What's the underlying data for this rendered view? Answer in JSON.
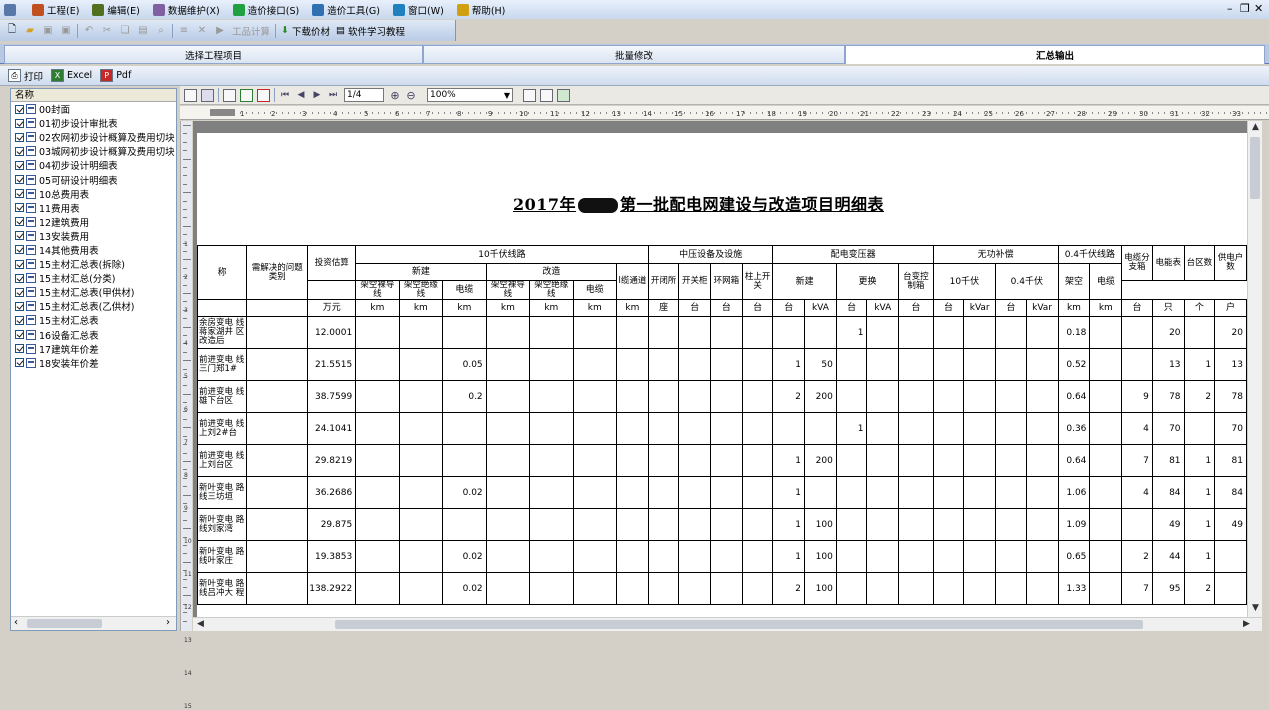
{
  "menu": [
    {
      "label": "工程(E)",
      "icon": "project-icon",
      "color": "#c05020"
    },
    {
      "label": "编辑(E)",
      "icon": "edit-icon",
      "color": "#507020"
    },
    {
      "label": "数据维护(X)",
      "icon": "data-maintain-icon",
      "color": "#8060a0"
    },
    {
      "label": "造价接口(S)",
      "icon": "cost-interface-icon",
      "color": "#20a040"
    },
    {
      "label": "造价工具(G)",
      "icon": "cost-tool-icon",
      "color": "#3070b0"
    },
    {
      "label": "窗口(W)",
      "icon": "window-icon",
      "color": "#2080c0"
    },
    {
      "label": "帮助(H)",
      "icon": "help-icon",
      "color": "#d0a010"
    }
  ],
  "toolbar": {
    "calc_label": "工品计算",
    "download_label": "下载价材",
    "tutorial_label": "软件学习教程"
  },
  "tabs": [
    "选择工程项目",
    "批量修改",
    "汇总输出"
  ],
  "export_toolbar": {
    "print": "打印",
    "excel": "Excel",
    "pdf": "Pdf"
  },
  "tree": {
    "header": "名称",
    "items": [
      "00封面",
      "01初步设计审批表",
      "02农网初步设计概算及费用切块",
      "03城网初步设计概算及费用切块",
      "04初步设计明细表",
      "05可研设计明细表",
      "10总费用表",
      "11费用表",
      "12建筑费用",
      "13安装费用",
      "14其他费用表",
      "15主材汇总表(拆除)",
      "15主材汇总(分类)",
      "15主材汇总表(甲供材)",
      "15主材汇总表(乙供材)",
      "15主材汇总表",
      "16设备汇总表",
      "17建筑年价差",
      "18安装年价差"
    ]
  },
  "viewer": {
    "page": "1/4",
    "zoom": "100%"
  },
  "ruler": [
    "1",
    "2",
    "3",
    "4",
    "5",
    "6",
    "7",
    "8",
    "9",
    "10",
    "11",
    "12",
    "13",
    "14",
    "15",
    "16",
    "17",
    "18",
    "19",
    "20",
    "21",
    "22",
    "23",
    "24",
    "25",
    "26",
    "27",
    "28",
    "29",
    "30",
    "31",
    "32",
    "33"
  ],
  "vruler": [
    "1",
    "2",
    "3",
    "4",
    "5",
    "6",
    "7",
    "8",
    "9",
    "10",
    "11",
    "12",
    "13",
    "14",
    "15"
  ],
  "report": {
    "title_prefix": "2017年",
    "title_suffix": "第一批配电网建设与改造项目明细表",
    "headers": {
      "name": "称",
      "category": "需解决的问题类别",
      "investment": "投资估算",
      "unit_wanyuan": "万元",
      "kv10": "10千伏线路",
      "mv": "中压设备及设施",
      "transformer": "配电变压器",
      "reactive": "无功补偿",
      "kv04": "0.4千伏线路",
      "cable_branch": "电缆分支箱",
      "meter": "电能表",
      "area_count": "台区数",
      "supply": "供电户数",
      "new": "新建",
      "rebuild": "改造",
      "overhead_bare": "架空裸导线",
      "overhead_insulated": "架空绝缘线",
      "cable": "电缆",
      "cable_channel": "l缆通道",
      "switch_station": "开闭所",
      "switch_cabinet": "开关柜",
      "ring_unit": "环网箱",
      "pole_switch": "柱上开关",
      "tr_new": "新建",
      "tr_replace": "更换",
      "tr_control": "台变控制箱",
      "rc_10kv": "10千伏",
      "rc_04kv": "0.4千伏",
      "lv_overhead": "架空",
      "lv_cable": "电缆",
      "units": [
        "km",
        "km",
        "km",
        "km",
        "km",
        "km",
        "km",
        "座",
        "台",
        "台",
        "台",
        "台",
        "kVA",
        "台",
        "kVA",
        "台",
        "台",
        "kVar",
        "台",
        "kVar",
        "km",
        "km",
        "台",
        "只",
        "个",
        "户"
      ]
    },
    "rows": [
      {
        "name": "余房变电 线蒋家湖井 区改造后",
        "inv": "12.0001",
        "ins": "",
        "tnew": "",
        "tkva": "",
        "trep": "1",
        "lvo": "0.18",
        "box": "",
        "meter": "20",
        "area": "",
        "sup": "20"
      },
      {
        "name": "前进变电 线三门郑1#",
        "inv": "21.5515",
        "ins": "0.05",
        "tnew": "1",
        "tkva": "50",
        "trep": "",
        "lvo": "0.52",
        "box": "",
        "meter": "13",
        "area": "1",
        "sup": "13"
      },
      {
        "name": "前进变电 线雄下台区",
        "inv": "38.7599",
        "ins": "0.2",
        "tnew": "2",
        "tkva": "200",
        "trep": "",
        "lvo": "0.64",
        "box": "9",
        "meter": "78",
        "area": "2",
        "sup": "78"
      },
      {
        "name": "前进变电 线上刘2#台",
        "inv": "24.1041",
        "ins": "",
        "tnew": "",
        "tkva": "",
        "trep": "1",
        "lvo": "0.36",
        "box": "4",
        "meter": "70",
        "area": "",
        "sup": "70"
      },
      {
        "name": "前进变电 线上刘台区",
        "inv": "29.8219",
        "ins": "",
        "tnew": "1",
        "tkva": "200",
        "trep": "",
        "lvo": "0.64",
        "box": "7",
        "meter": "81",
        "area": "1",
        "sup": "81"
      },
      {
        "name": "新叶变电 路线三坊垣",
        "inv": "36.2686",
        "ins": "0.02",
        "tnew": "1",
        "tkva": "",
        "trep": "",
        "lvo": "1.06",
        "box": "4",
        "meter": "84",
        "area": "1",
        "sup": "84"
      },
      {
        "name": "新叶变电 路线刘家湾",
        "inv": "29.875",
        "ins": "",
        "tnew": "1",
        "tkva": "100",
        "trep": "",
        "lvo": "1.09",
        "box": "",
        "meter": "49",
        "area": "1",
        "sup": "49"
      },
      {
        "name": "新叶变电 路线叶家庄",
        "inv": "19.3853",
        "ins": "0.02",
        "tnew": "1",
        "tkva": "100",
        "trep": "",
        "lvo": "0.65",
        "box": "2",
        "meter": "44",
        "area": "1",
        "sup": ""
      },
      {
        "name": "新叶变电 路线吕冲大 程",
        "inv": "138.2922",
        "ins": "0.02",
        "tnew": "2",
        "tkva": "100",
        "trep": "",
        "lvo": "1.33",
        "box": "7",
        "meter": "95",
        "area": "2",
        "sup": ""
      }
    ]
  }
}
